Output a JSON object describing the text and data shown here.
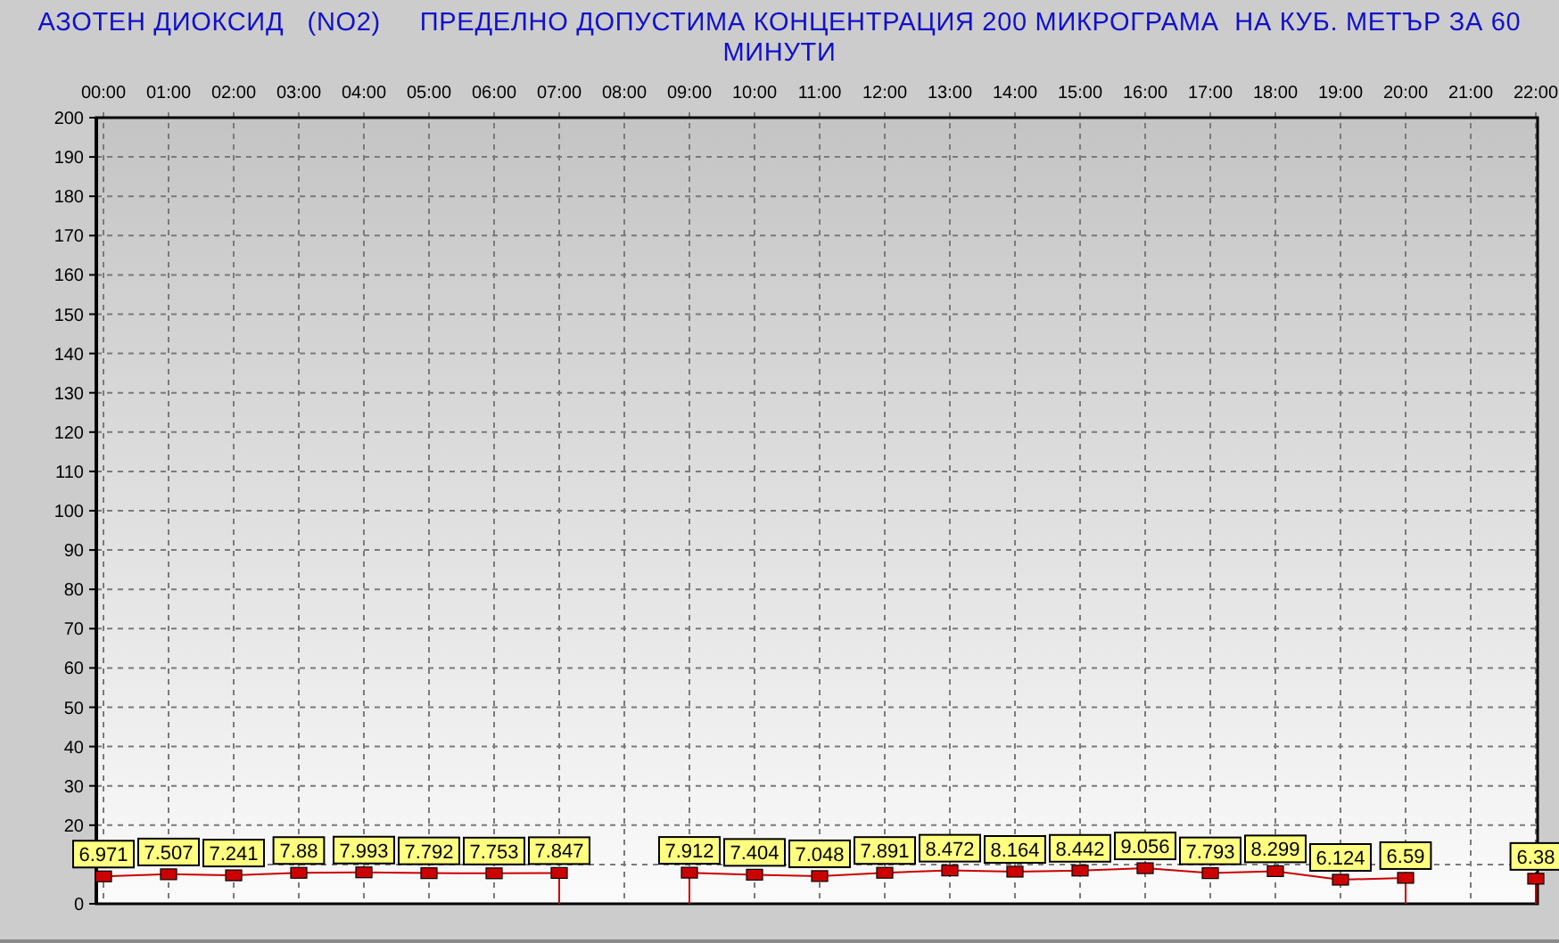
{
  "chart": {
    "title": "АЗОТЕН ДИОКСИД   (NO2)     ПРЕДЕЛНО ДОПУСТИМА КОНЦЕНТРАЦИЯ 200 МИКРОГРАМА  НА КУБ. МЕТЪР ЗА 60 МИНУТИ",
    "chart_data": {
      "type": "line",
      "data_labels": true,
      "grid": true,
      "categories": [
        "00:00",
        "01:00",
        "02:00",
        "03:00",
        "04:00",
        "05:00",
        "06:00",
        "07:00",
        "08:00",
        "09:00",
        "10:00",
        "11:00",
        "12:00",
        "13:00",
        "14:00",
        "15:00",
        "16:00",
        "17:00",
        "18:00",
        "19:00",
        "20:00",
        "21:00",
        "22:00"
      ],
      "ylim": [
        0,
        200
      ],
      "yticks": [
        0,
        20,
        30,
        40,
        50,
        60,
        70,
        80,
        90,
        100,
        110,
        120,
        130,
        140,
        150,
        160,
        170,
        180,
        190,
        200
      ],
      "series": [
        {
          "color": "#cc0000",
          "marker": "square",
          "values": [
            6.971,
            7.507,
            7.241,
            7.88,
            7.993,
            7.792,
            7.753,
            7.847,
            null,
            7.912,
            7.404,
            7.048,
            7.891,
            8.472,
            8.164,
            8.442,
            9.056,
            7.793,
            8.299,
            6.124,
            6.59,
            null,
            6.38
          ]
        }
      ]
    }
  }
}
